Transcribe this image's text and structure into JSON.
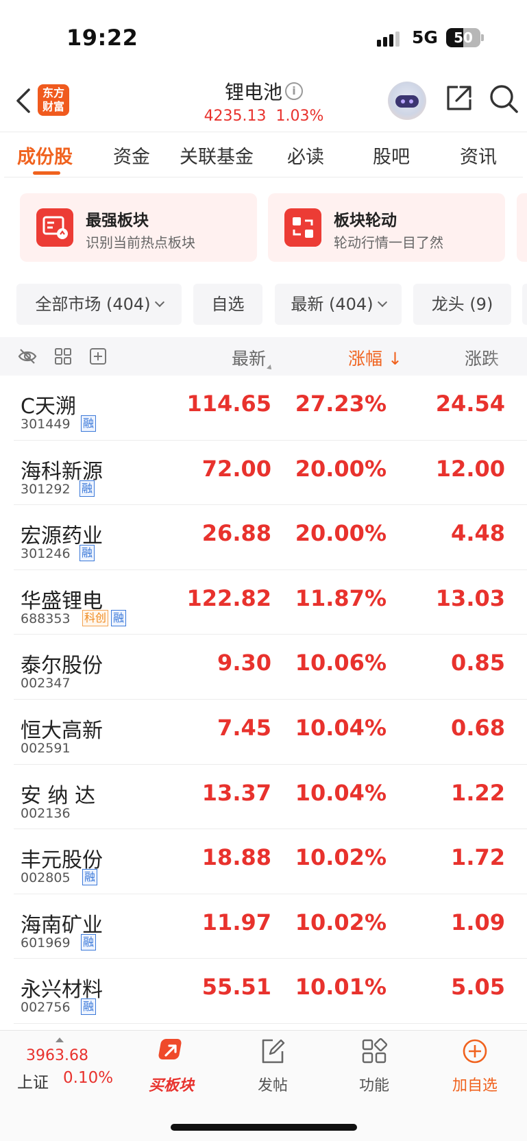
{
  "status": {
    "time": "19:22",
    "network": "5G",
    "battery": "50",
    "battery_level": 0.5
  },
  "header": {
    "logo": "东方财富",
    "title": "锂电池",
    "index_value": "4235.13",
    "index_pct": "1.03%"
  },
  "tabs": [
    "成份股",
    "资金",
    "关联基金",
    "必读",
    "股吧",
    "资讯"
  ],
  "cards": [
    {
      "title": "最强板块",
      "subtitle": "识别当前热点板块"
    },
    {
      "title": "板块轮动",
      "subtitle": "轮动行情一目了然"
    }
  ],
  "filters": [
    "全部市场 (404)",
    "自选",
    "最新 (404)",
    "龙头 (9)"
  ],
  "list_header": {
    "price": "最新",
    "pct": "涨幅",
    "pct_arrow": "↓",
    "change": "涨跌"
  },
  "badges": {
    "rong": "融",
    "kc": "科创"
  },
  "stocks": [
    {
      "name": "C天溯",
      "code": "301449",
      "price": "114.65",
      "pct": "27.23%",
      "change": "24.54"
    },
    {
      "name": "海科新源",
      "code": "301292",
      "price": "72.00",
      "pct": "20.00%",
      "change": "12.00"
    },
    {
      "name": "宏源药业",
      "code": "301246",
      "price": "26.88",
      "pct": "20.00%",
      "change": "4.48"
    },
    {
      "name": "华盛锂电",
      "code": "688353",
      "price": "122.82",
      "pct": "11.87%",
      "change": "13.03"
    },
    {
      "name": "泰尔股份",
      "code": "002347",
      "price": "9.30",
      "pct": "10.06%",
      "change": "0.85"
    },
    {
      "name": "恒大高新",
      "code": "002591",
      "price": "7.45",
      "pct": "10.04%",
      "change": "0.68"
    },
    {
      "name": "安 纳 达",
      "code": "002136",
      "price": "13.37",
      "pct": "10.04%",
      "change": "1.22"
    },
    {
      "name": "丰元股份",
      "code": "002805",
      "price": "18.88",
      "pct": "10.02%",
      "change": "1.72"
    },
    {
      "name": "海南矿业",
      "code": "601969",
      "price": "11.97",
      "pct": "10.02%",
      "change": "1.09"
    },
    {
      "name": "永兴材料",
      "code": "002756",
      "price": "55.51",
      "pct": "10.01%",
      "change": "5.05"
    }
  ],
  "bottom": {
    "index_value": "3963.68",
    "index_name": "上证",
    "index_pct": "0.10%",
    "nav": [
      "买板块",
      "发帖",
      "功能",
      "加自选"
    ]
  },
  "colors": {
    "accent": "#f0621e",
    "up": "#e8322d",
    "rong_badge": "#3a78d8",
    "kc_badge": "#f08a1e"
  }
}
